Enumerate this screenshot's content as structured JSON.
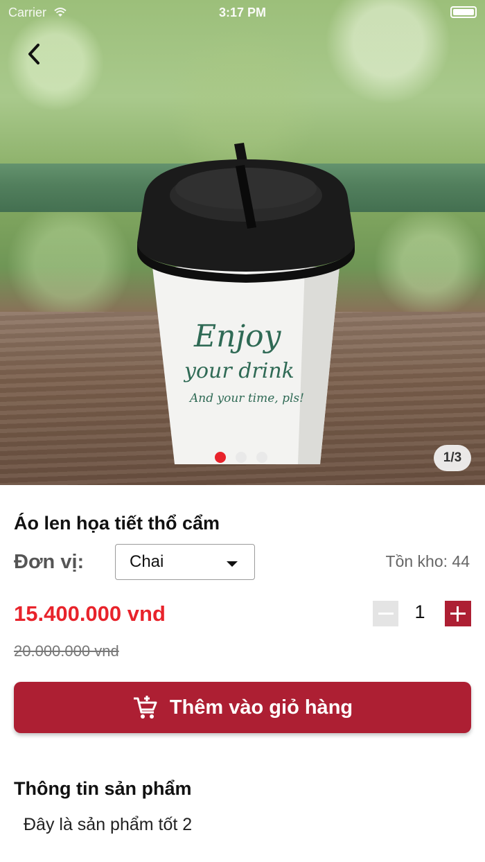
{
  "status_bar": {
    "carrier": "Carrier",
    "time": "3:17 PM"
  },
  "gallery": {
    "cup_text_line1": "Enjoy",
    "cup_text_line2": "your drink",
    "cup_text_line3": "And your time, pls!",
    "page_counter": "1/3",
    "active_index": 0,
    "total": 3,
    "dot_active_color": "#e8232b"
  },
  "product": {
    "name": "Áo len họa tiết thổ cẩm",
    "unit_label": "Đơn vị:",
    "unit_value": "Chai",
    "stock_text": "Tồn kho: 44",
    "price": "15.400.000 vnd",
    "old_price": "20.000.000 vnd",
    "quantity": "1"
  },
  "actions": {
    "add_to_cart_label": "Thêm vào giỏ hàng"
  },
  "info": {
    "title": "Thông tin sản phẩm",
    "body": "Đây là sản phẩm tốt 2"
  },
  "colors": {
    "accent": "#ad1f33",
    "price": "#e8232b"
  },
  "icons": {
    "back": "chevron-left-icon",
    "cart": "add-to-cart-icon",
    "wifi": "wifi-icon"
  }
}
